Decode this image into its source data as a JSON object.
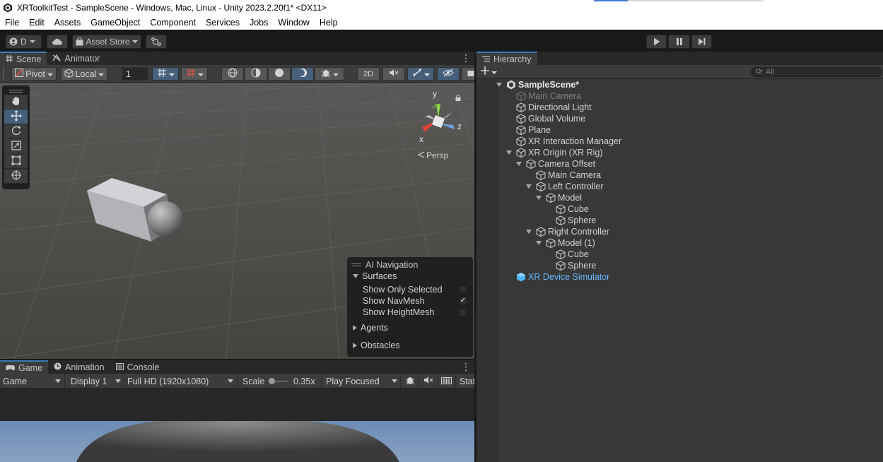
{
  "window": {
    "title": "XRToolkitTest - SampleScene - Windows, Mac, Linux - Unity 2023.2.20f1* <DX11>"
  },
  "menu": [
    "File",
    "Edit",
    "Assets",
    "GameObject",
    "Component",
    "Services",
    "Jobs",
    "Window",
    "Help"
  ],
  "toolbar": {
    "account_label": "D",
    "asset_store_label": "Asset Store",
    "icons": [
      "account-icon",
      "cloud-icon",
      "asset-store-icon",
      "version-control-icon",
      "play-icon",
      "pause-icon",
      "step-icon"
    ]
  },
  "scene_panel": {
    "tabs": [
      {
        "label": "Scene",
        "icon": "scene-icon",
        "active": true
      },
      {
        "label": "Animator",
        "icon": "animator-icon",
        "active": false
      }
    ],
    "pivot_label": "Pivot",
    "space_label": "Local",
    "snap_value": "1",
    "mode_2d_label": "2D",
    "persp_label": "Persp",
    "gizmo_axes": {
      "y": "y",
      "x": "x",
      "z": "z"
    },
    "tools": [
      "hand-tool-icon",
      "move-tool-icon",
      "rotate-tool-icon",
      "scale-tool-icon",
      "rect-tool-icon",
      "transform-tool-icon"
    ],
    "active_tool": "move-tool-icon"
  },
  "ai_navigation": {
    "title": "AI Navigation",
    "surfaces_label": "Surfaces",
    "options": [
      {
        "label": "Show Only Selected",
        "checked": false
      },
      {
        "label": "Show NavMesh",
        "checked": true
      },
      {
        "label": "Show HeightMesh",
        "checked": false
      }
    ],
    "agents_label": "Agents",
    "obstacles_label": "Obstacles"
  },
  "game_panel": {
    "tabs": [
      {
        "label": "Game",
        "icon": "game-icon",
        "active": true
      },
      {
        "label": "Animation",
        "icon": "animation-icon",
        "active": false
      },
      {
        "label": "Console",
        "icon": "console-icon",
        "active": false
      }
    ],
    "view_mode": "Game",
    "display": "Display 1",
    "resolution": "Full HD (1920x1080)",
    "scale_label": "Scale",
    "scale_value": "0.35x",
    "play_mode": "Play Focused",
    "stats_label": "Stats"
  },
  "hierarchy": {
    "tab_label": "Hierarchy",
    "search_placeholder": "All",
    "items": [
      {
        "label": "SampleScene*",
        "depth": 0,
        "expanded": true,
        "type": "scene",
        "bold": true
      },
      {
        "label": "Main Camera",
        "depth": 1,
        "type": "object",
        "disabled": true
      },
      {
        "label": "Directional Light",
        "depth": 1,
        "type": "object"
      },
      {
        "label": "Global Volume",
        "depth": 1,
        "type": "object"
      },
      {
        "label": "Plane",
        "depth": 1,
        "type": "object"
      },
      {
        "label": "XR Interaction Manager",
        "depth": 1,
        "type": "object"
      },
      {
        "label": "XR Origin (XR Rig)",
        "depth": 1,
        "expanded": true,
        "type": "object"
      },
      {
        "label": "Camera Offset",
        "depth": 2,
        "expanded": true,
        "type": "object"
      },
      {
        "label": "Main Camera",
        "depth": 3,
        "type": "object"
      },
      {
        "label": "Left Controller",
        "depth": 3,
        "expanded": true,
        "type": "object"
      },
      {
        "label": "Model",
        "depth": 4,
        "expanded": true,
        "type": "object"
      },
      {
        "label": "Cube",
        "depth": 5,
        "type": "object"
      },
      {
        "label": "Sphere",
        "depth": 5,
        "type": "object"
      },
      {
        "label": "Right Controller",
        "depth": 3,
        "expanded": true,
        "type": "object"
      },
      {
        "label": "Model (1)",
        "depth": 4,
        "expanded": true,
        "type": "object"
      },
      {
        "label": "Cube",
        "depth": 5,
        "type": "object"
      },
      {
        "label": "Sphere",
        "depth": 5,
        "type": "object"
      },
      {
        "label": "XR Device Simulator",
        "depth": 1,
        "type": "prefab"
      }
    ]
  },
  "colors": {
    "editor_bg": "#383838",
    "panel_dark": "#282828",
    "selection_blue": "#46607c",
    "prefab_blue": "#6ab8ff",
    "disabled_text": "#7f7f7f"
  }
}
